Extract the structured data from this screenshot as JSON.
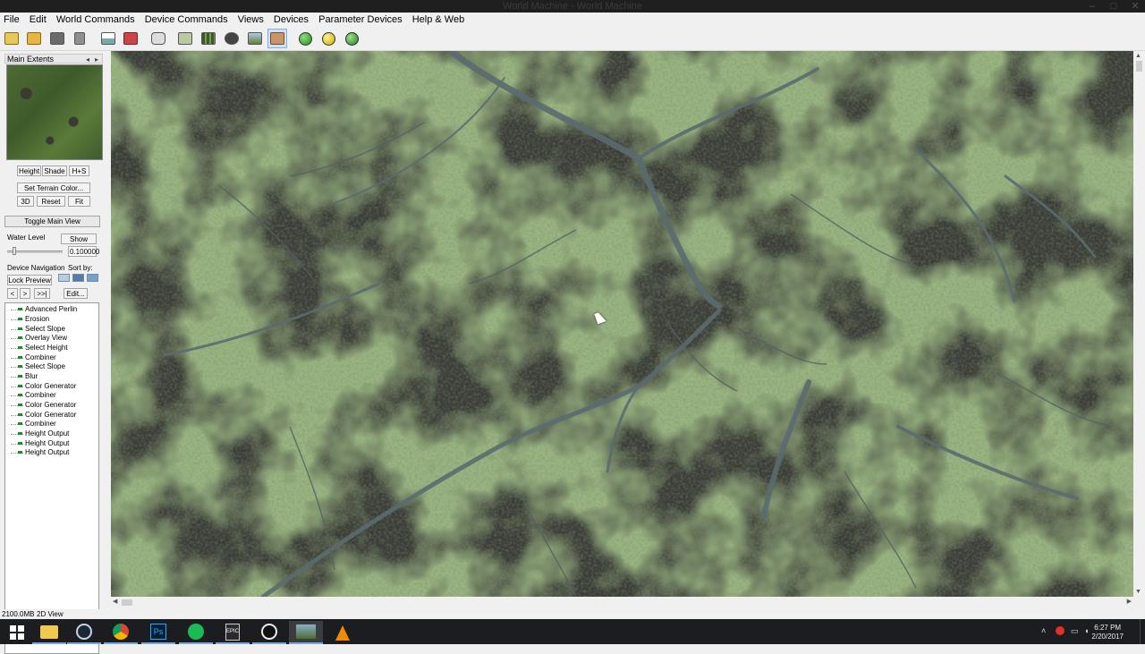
{
  "window": {
    "title": "World Machine - World Machine",
    "min": "–",
    "max": "□",
    "close": "✕"
  },
  "menu": [
    "File",
    "Edit",
    "World Commands",
    "Device Commands",
    "Views",
    "Devices",
    "Parameter Devices",
    "Help & Web"
  ],
  "toolbar": {
    "icons": [
      "new-file-icon",
      "open-folder-icon",
      "save-icon",
      "tools-icon",
      "chart-icon",
      "render-icon",
      "dice-icon",
      "layout-view-icon",
      "grid-view-icon",
      "globe-icon",
      "terrain-icon",
      "texture-view-icon",
      "green-orb-icon",
      "yellow-orb-icon",
      "world-orb-icon"
    ]
  },
  "left_panel": {
    "panel_title": "Main Extents",
    "view_buttons": [
      "Height",
      "Shade",
      "H+S"
    ],
    "set_terrain_color": "Set Terrain Color...",
    "nav_buttons": [
      "3D",
      "Reset",
      "Fit"
    ],
    "toggle_main_view": "Toggle Main View",
    "water_level_label": "Water Level",
    "show_button": "Show",
    "water_level_value": "0.100000",
    "water_level_fraction": 0.1,
    "device_navigation_label": "Device Navigation",
    "sort_by_label": "Sort by:",
    "lock_preview": "Lock Preview",
    "step_buttons": [
      "<",
      ">",
      ">>|"
    ],
    "edit_button": "Edit...",
    "devices": [
      "Advanced Perlin",
      "Erosion",
      "Select Slope",
      "Overlay View",
      "Select Height",
      "Combiner",
      "Select Slope",
      "Blur",
      "Color Generator",
      "Combiner",
      "Color Generator",
      "Color Generator",
      "Combiner",
      "Height Output",
      "Height Output",
      "Height Output"
    ]
  },
  "status": {
    "memory": "2100.0MB",
    "mode": "2D View"
  },
  "taskbar": {
    "apps": [
      "start-icon",
      "file-explorer-icon",
      "steam-icon",
      "chrome-icon",
      "photoshop-icon",
      "spotify-icon",
      "epic-games-icon",
      "unreal-engine-icon",
      "world-machine-icon",
      "vlc-icon"
    ],
    "time": "6:27 PM",
    "date": "2/20/2017"
  }
}
